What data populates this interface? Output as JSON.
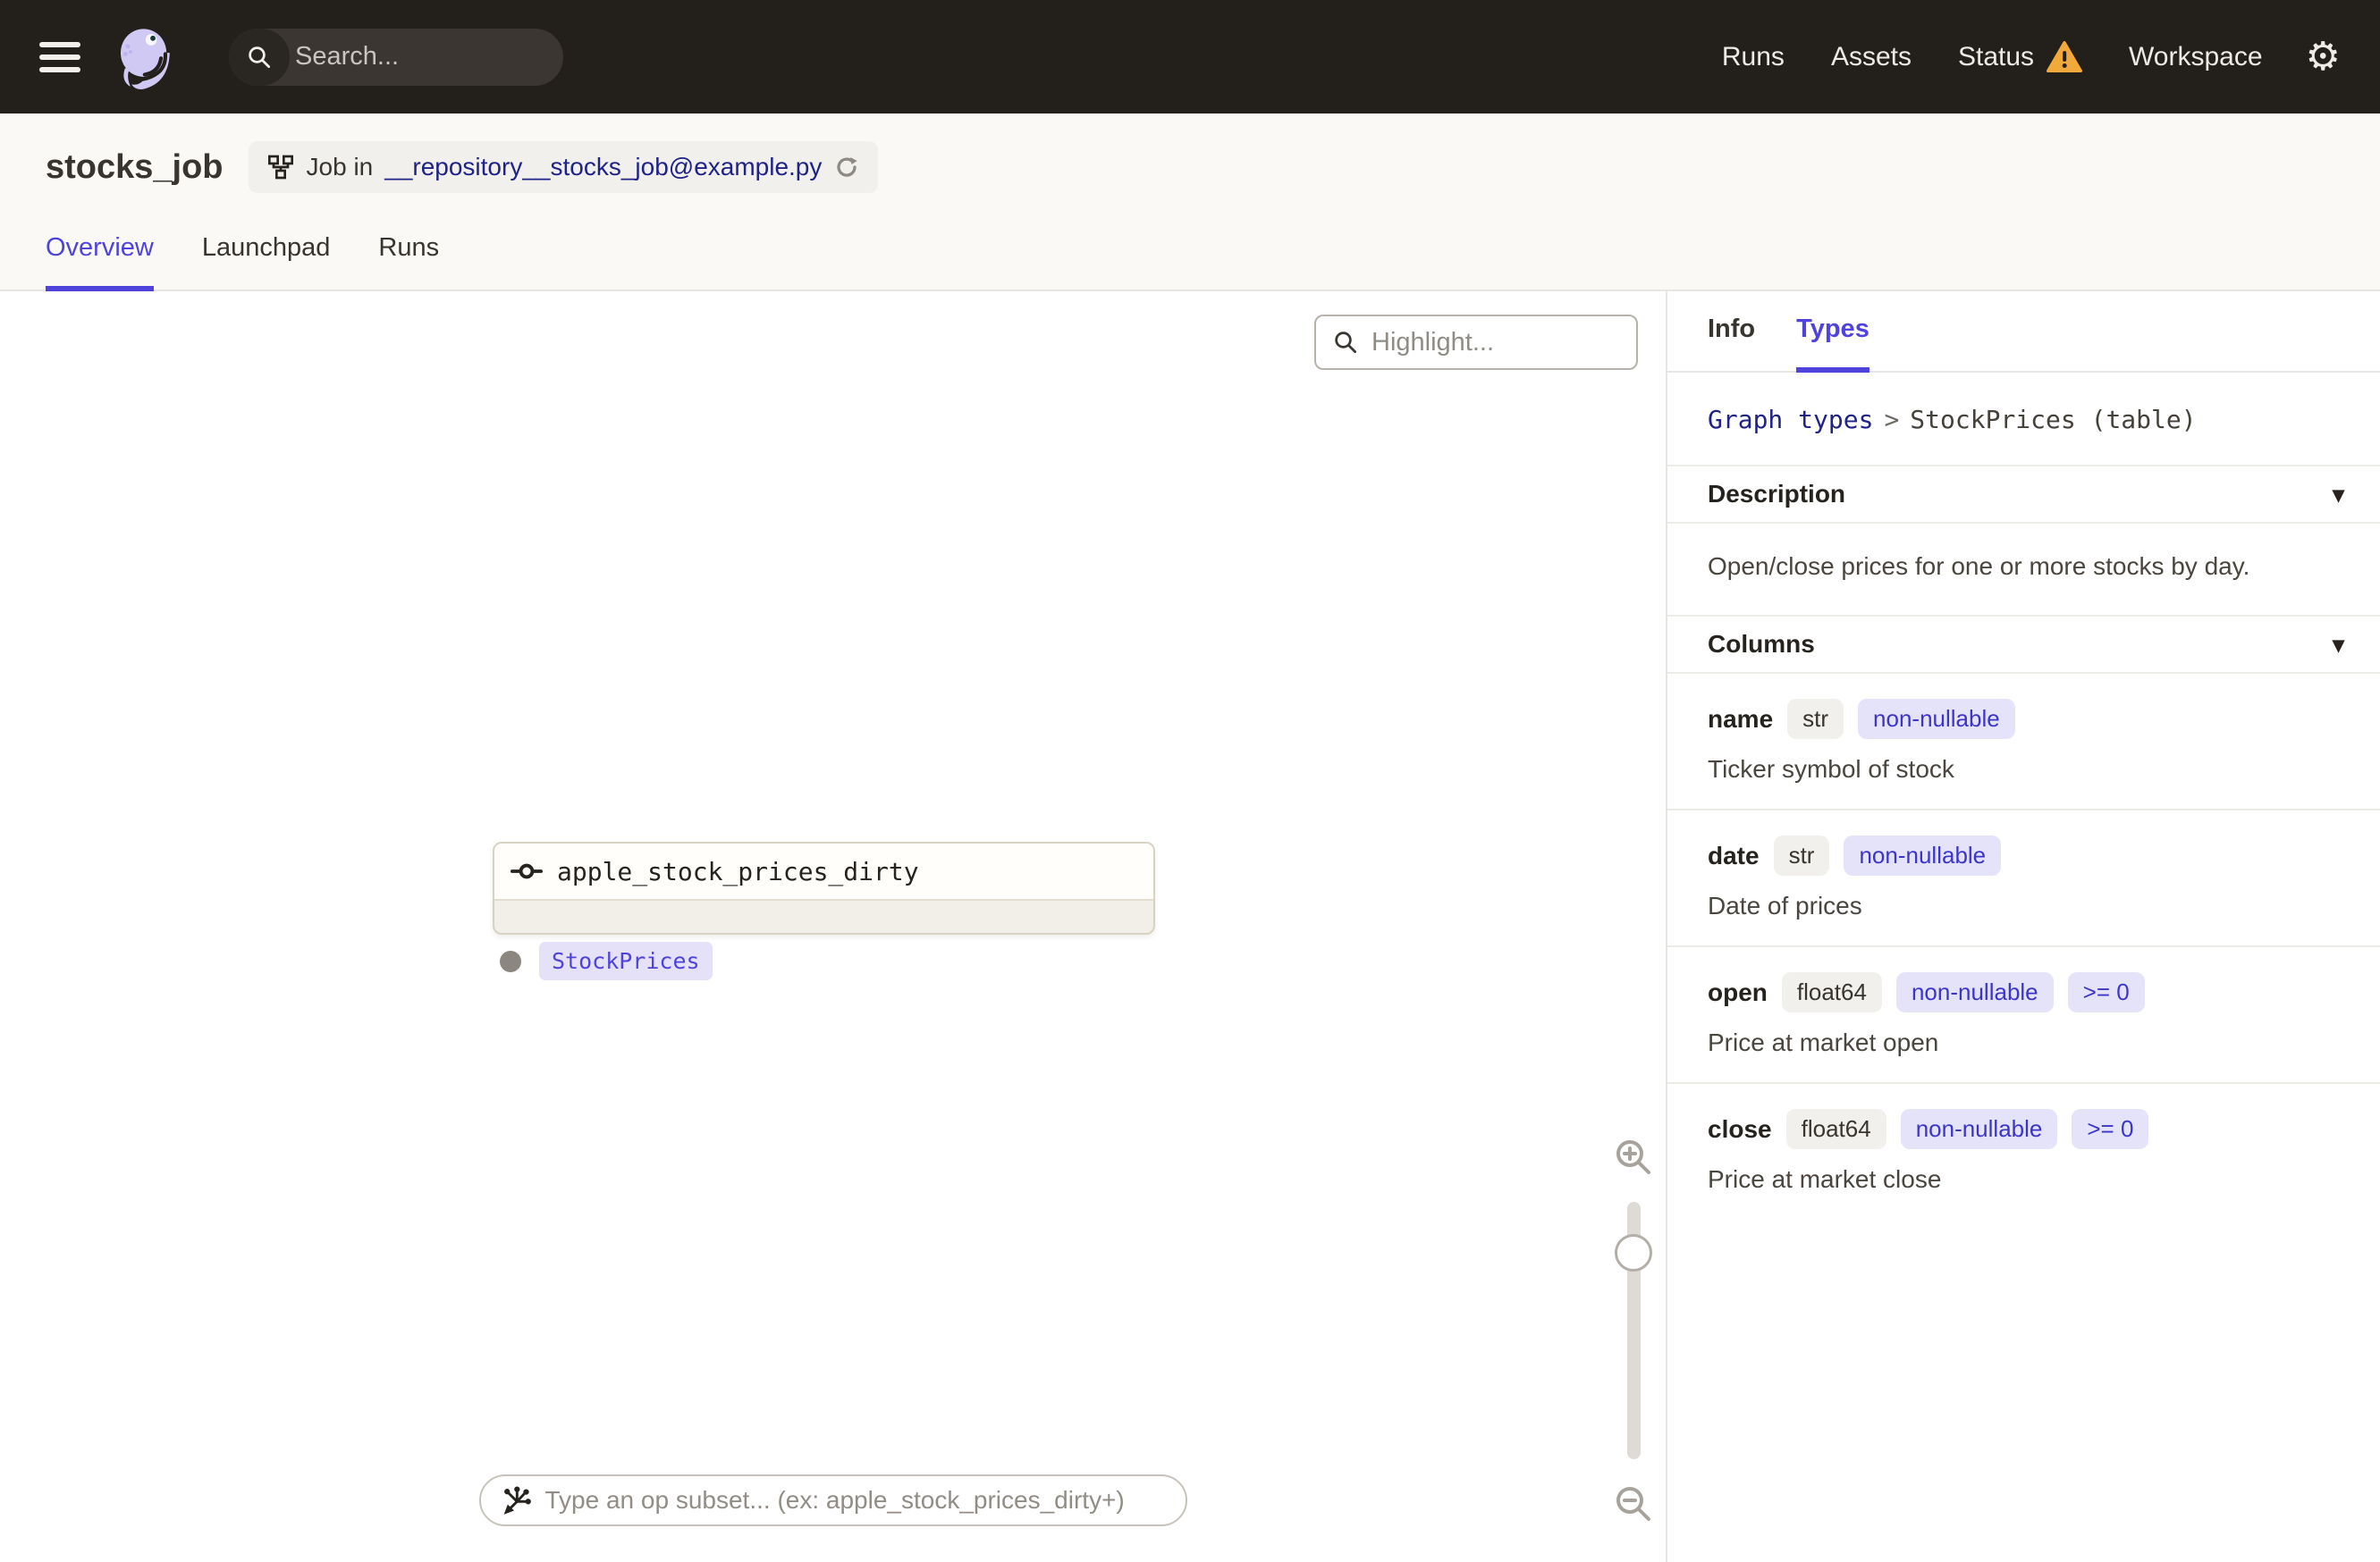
{
  "topbar": {
    "search": {
      "placeholder": "Search...",
      "shortcut": "/"
    },
    "nav": [
      {
        "label": "Runs"
      },
      {
        "label": "Assets"
      },
      {
        "label": "Status"
      },
      {
        "label": "Workspace"
      }
    ]
  },
  "header": {
    "title": "stocks_job",
    "job_badge": {
      "prefix": "Job in",
      "link": "__repository__stocks_job@example.py"
    },
    "tabs": [
      {
        "label": "Overview"
      },
      {
        "label": "Launchpad"
      },
      {
        "label": "Runs"
      }
    ]
  },
  "graph": {
    "highlight_placeholder": "Highlight...",
    "node": {
      "label": "apple_stock_prices_dirty",
      "output_tag": "StockPrices"
    },
    "op_subset_placeholder": "Type an op subset... (ex: apple_stock_prices_dirty+)"
  },
  "sidebar": {
    "tabs": [
      {
        "label": "Info"
      },
      {
        "label": "Types"
      }
    ],
    "breadcrumb": {
      "link": "Graph types",
      "separator": ">",
      "current": "StockPrices (table)"
    },
    "description": {
      "title": "Description",
      "body": "Open/close prices for one or more stocks by day."
    },
    "columns": {
      "title": "Columns",
      "rows": [
        {
          "name": "name",
          "type": "str",
          "constraints": [
            "non-nullable"
          ],
          "description": "Ticker symbol of stock"
        },
        {
          "name": "date",
          "type": "str",
          "constraints": [
            "non-nullable"
          ],
          "description": "Date of prices"
        },
        {
          "name": "open",
          "type": "float64",
          "constraints": [
            "non-nullable",
            ">= 0"
          ],
          "description": "Price at market open"
        },
        {
          "name": "close",
          "type": "float64",
          "constraints": [
            "non-nullable",
            ">= 0"
          ],
          "description": "Price at market close"
        }
      ]
    }
  },
  "icons": {
    "chevron_down": "▾",
    "gear": "⚙"
  },
  "colors": {
    "accent": "#4F43DD",
    "link_navy": "#1F2287",
    "warning": "#F2A93C",
    "topbar_bg": "#231F1B",
    "constraint_bg": "#E5E3FA",
    "constraint_text": "#3B35C9",
    "node_border": "#D8D2C2",
    "tag_bg": "#E4E1F9"
  }
}
